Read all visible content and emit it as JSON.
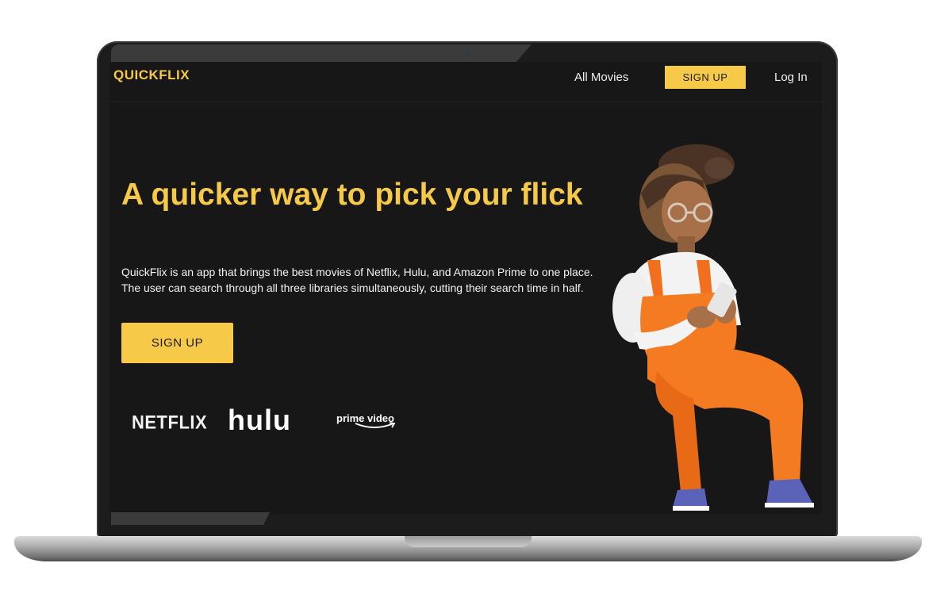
{
  "header": {
    "brand": "QUICKFLIX",
    "nav": {
      "all_movies": "All Movies",
      "sign_up": "SIGN UP",
      "log_in": "Log In"
    }
  },
  "hero": {
    "headline": "A quicker way to pick your flick",
    "description": "QuickFlix is an app that brings the best movies of Netflix, Hulu, and Amazon Prime to one place. The user can search through all three libraries simultaneously, cutting their search time in half.",
    "cta_label": "SIGN UP"
  },
  "partners": {
    "netflix": "NETFLIX",
    "hulu": "hulu",
    "prime_video": "prime video"
  },
  "colors": {
    "accent": "#f7c948",
    "background": "#171717",
    "text": "#f2f2f2"
  },
  "icons": {
    "prime_smile": "amazon-smile-arrow",
    "illustration": "person-using-phone-illustration"
  }
}
